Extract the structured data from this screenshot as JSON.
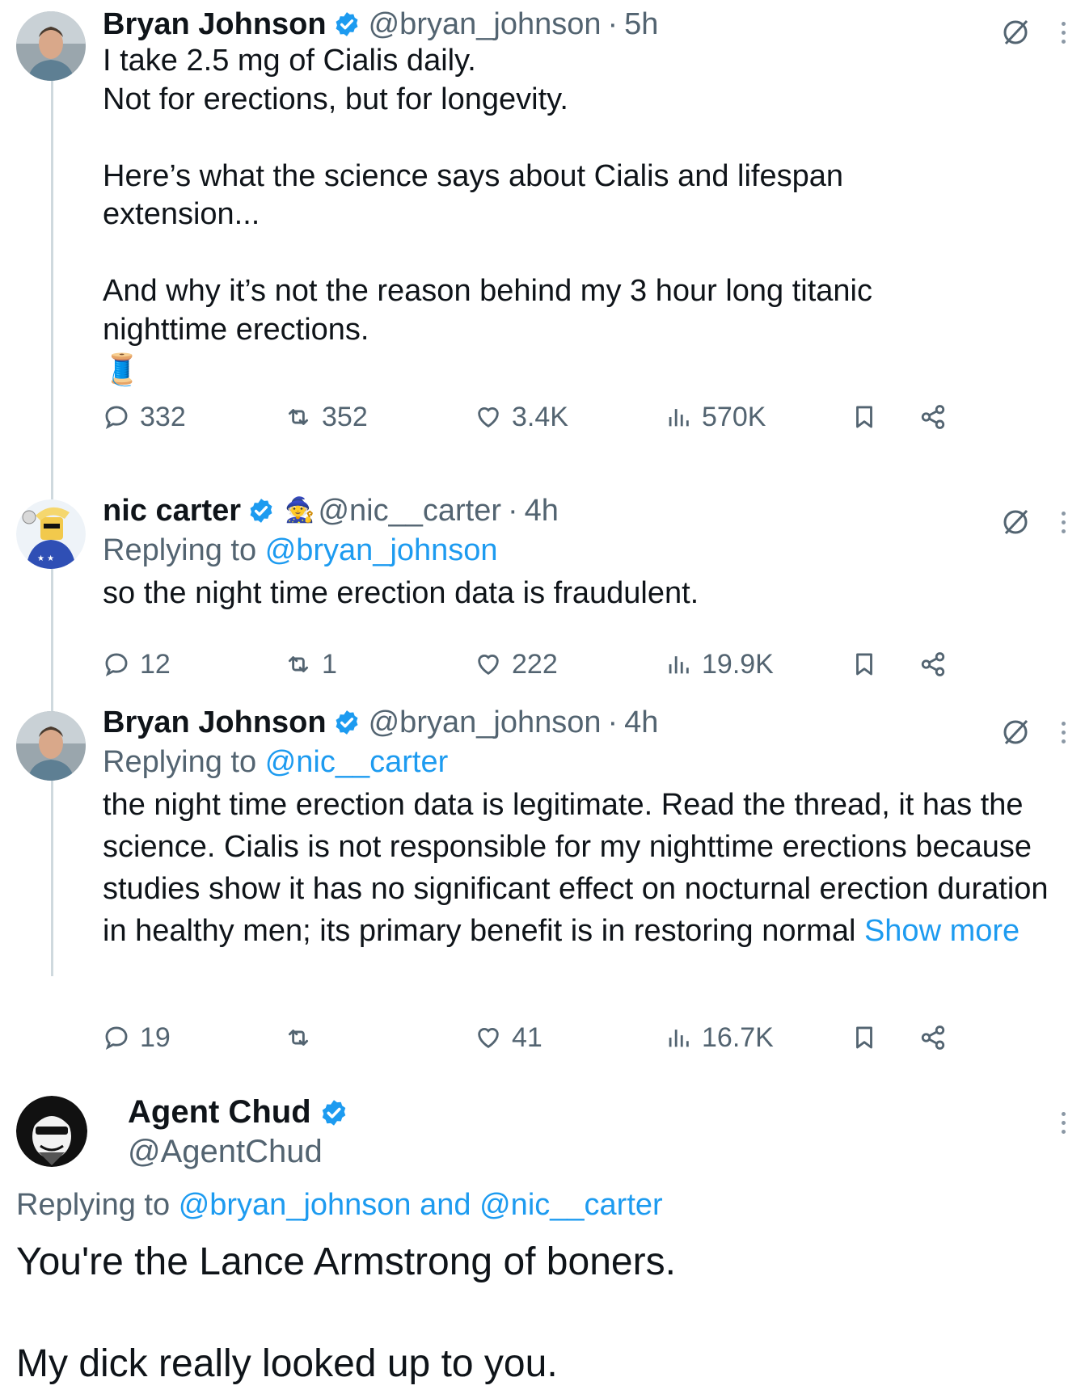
{
  "tweets": [
    {
      "name": "Bryan Johnson",
      "handle": "@bryan_johnson",
      "time": "5h",
      "replying_prefix": "",
      "replying_to": "",
      "text": "I take 2.5 mg of Cialis daily.\nNot for erections, but for longevity.\n\nHere’s what the science says about Cialis and lifespan extension...\n\nAnd why it’s not the reason behind my 3 hour long titanic nighttime erections.",
      "emoji": "🧵",
      "stats": {
        "replies": "332",
        "reposts": "352",
        "likes": "3.4K",
        "views": "570K"
      }
    },
    {
      "name": "nic carter",
      "handle_emoji": "🧙",
      "handle": "@nic__carter",
      "time": "4h",
      "replying_prefix": "Replying to",
      "replying_to": "@bryan_johnson",
      "text": "so the night time erection data is fraudulent.",
      "stats": {
        "replies": "12",
        "reposts": "1",
        "likes": "222",
        "views": "19.9K"
      }
    },
    {
      "name": "Bryan Johnson",
      "handle": "@bryan_johnson",
      "time": "4h",
      "replying_prefix": "Replying to",
      "replying_to": "@nic__carter",
      "text": "the night time erection data is legitimate. Read the thread, it has the science. Cialis is not responsible for my nighttime erections because studies show it has no significant effect on nocturnal erection duration in healthy men; its primary benefit is in restoring normal",
      "show_more": "Show more",
      "stats": {
        "replies": "19",
        "reposts": "",
        "likes": "41",
        "views": "16.7K"
      }
    }
  ],
  "focused_tweet": {
    "name": "Agent Chud",
    "handle": "@AgentChud",
    "replying_prefix": "Replying to",
    "replying_to_1": "@bryan_johnson",
    "replying_and": "and",
    "replying_to_2": "@nic__carter",
    "text": "You're the Lance Armstrong of boners.\n\nMy dick really looked up to you."
  },
  "colors": {
    "accent": "#1d9bf0",
    "secondary_text": "#536471",
    "thread_line": "#cfd9de"
  },
  "icons": [
    "verified-icon",
    "mute-icon",
    "more-icon",
    "reply-icon",
    "repost-icon",
    "like-icon",
    "views-icon",
    "bookmark-icon",
    "share-icon"
  ]
}
